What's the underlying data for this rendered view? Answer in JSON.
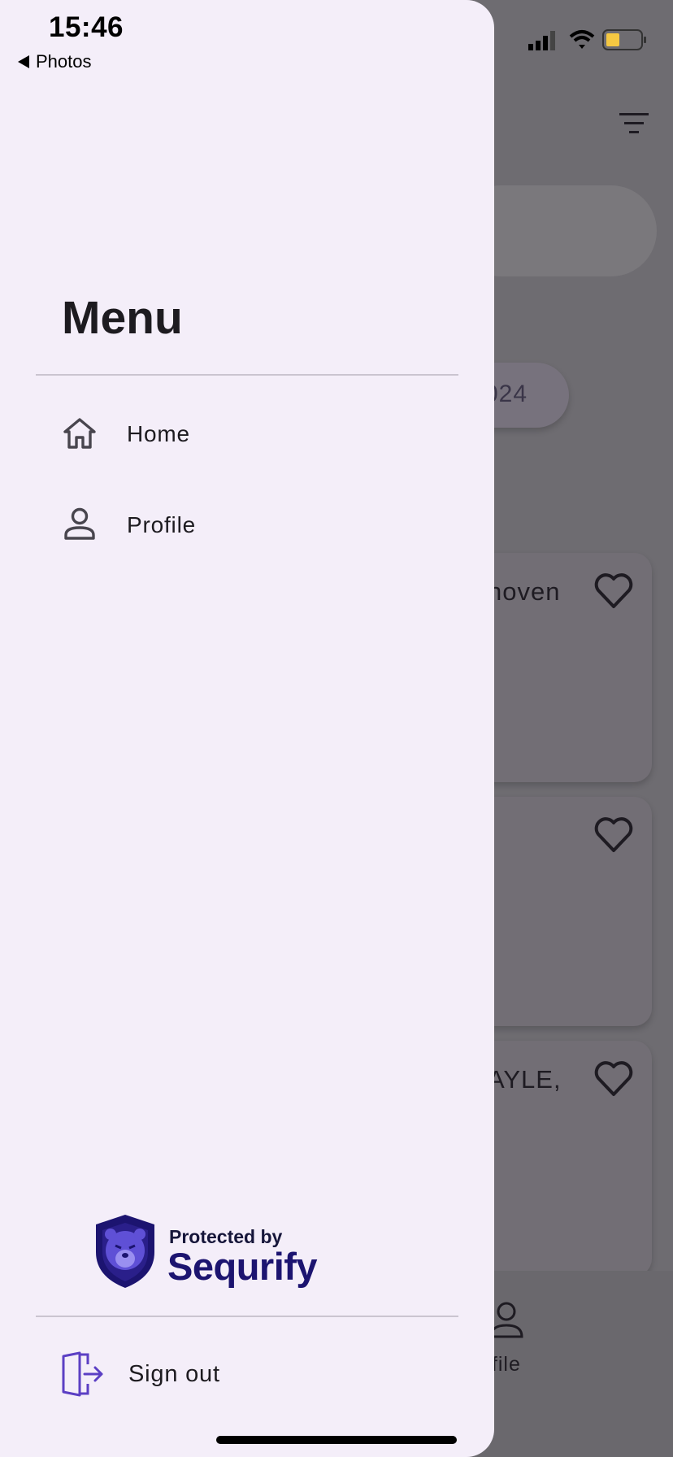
{
  "status_bar": {
    "time": "15:46",
    "back_label": "Photos"
  },
  "background": {
    "chip_text": "024",
    "cards": [
      {
        "text": "hoven"
      },
      {
        "text": ""
      },
      {
        "text": "AYLE,"
      }
    ],
    "tab_label": "ofile"
  },
  "drawer": {
    "title": "Menu",
    "items": [
      {
        "label": "Home",
        "icon": "home-icon"
      },
      {
        "label": "Profile",
        "icon": "person-icon"
      }
    ],
    "badge": {
      "protected_by": "Protected by",
      "brand": "Sequrify"
    },
    "sign_out": {
      "label": "Sign out",
      "icon": "sign-out-icon"
    }
  },
  "colors": {
    "drawer_bg": "#f4eef9",
    "scrim": "#6e6c71",
    "accent": "#5b3fc4",
    "brand_navy": "#1c1470"
  }
}
